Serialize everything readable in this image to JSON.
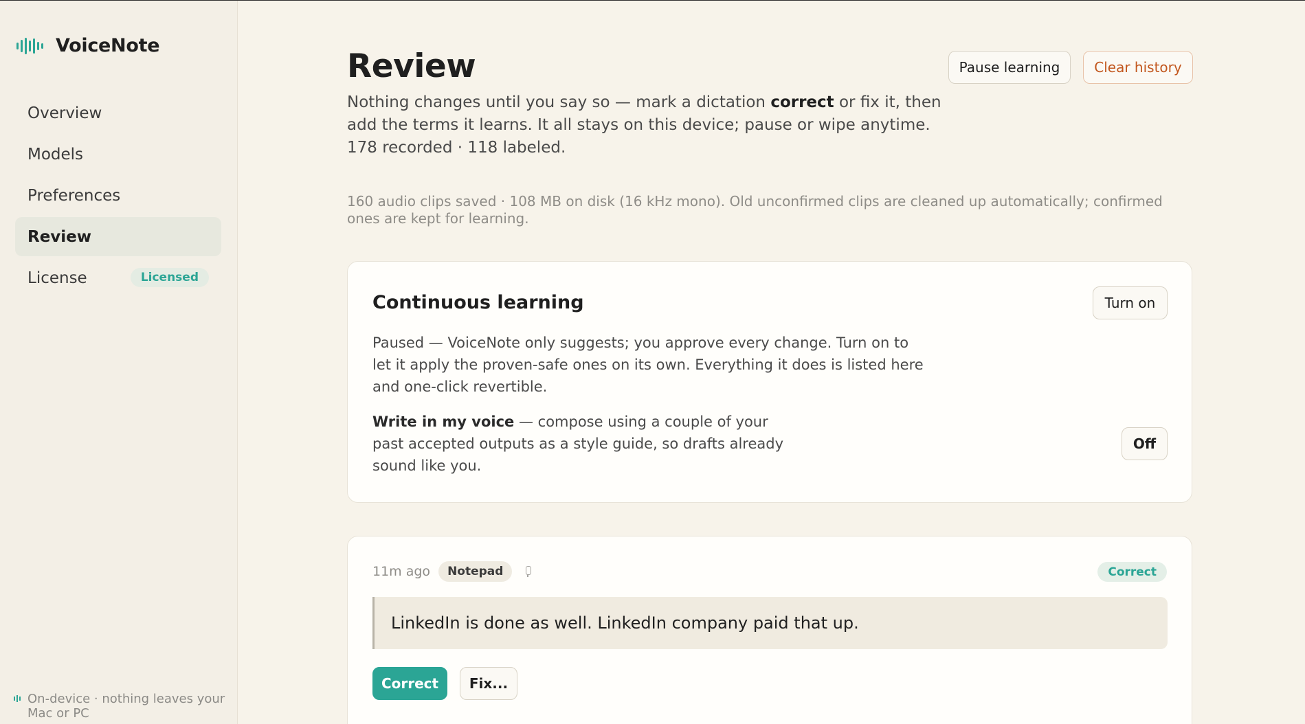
{
  "sidebar": {
    "brand": "VoiceNote",
    "items": [
      {
        "label": "Overview"
      },
      {
        "label": "Models"
      },
      {
        "label": "Preferences"
      },
      {
        "label": "Review"
      },
      {
        "label": "License",
        "badge": "Licensed"
      }
    ],
    "footer": "On-device · nothing leaves your Mac or PC"
  },
  "header": {
    "title": "Review",
    "pause_label": "Pause learning",
    "clear_label": "Clear history"
  },
  "intro": {
    "text_before": "Nothing changes until you say so — mark a dictation ",
    "emphasis": "correct",
    "text_after": " or fix it, then add the terms it learns. It all stays on this device; pause or wipe anytime. 178 recorded · 118 labeled."
  },
  "storage_note": "160 audio clips saved · 108 MB on disk (16 kHz mono). Old unconfirmed clips are cleaned up automatically; confirmed ones are kept for learning.",
  "learning": {
    "title": "Continuous learning",
    "turn_on_label": "Turn on",
    "description": "Paused — VoiceNote only suggests; you approve every change. Turn on to let it apply the proven-safe ones on its own. Everything it does is listed here and one-click revertible.",
    "voice_title": "Write in my voice",
    "voice_description": " — compose using a couple of your past accepted outputs as a style guide, so drafts already sound like you.",
    "voice_toggle_label": "Off"
  },
  "entry": {
    "time": "11m ago",
    "app": "Notepad",
    "status": "Correct",
    "text": "LinkedIn is done as well. LinkedIn company paid that up.",
    "correct_label": "Correct",
    "fix_label": "Fix..."
  },
  "colors": {
    "accent": "#2ba595",
    "danger": "#c2571e",
    "background": "#f7f3ea"
  }
}
